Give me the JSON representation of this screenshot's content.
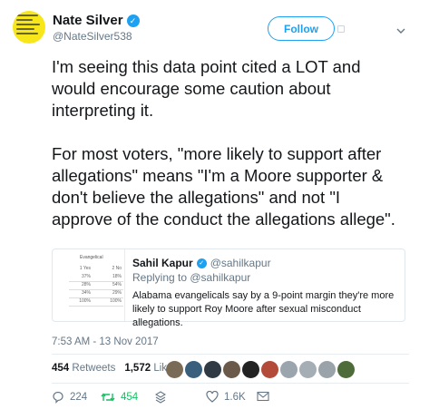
{
  "tweet": {
    "display_name": "Nate Silver",
    "handle": "@NateSilver538",
    "follow_label": "Follow",
    "verified_mark": "✓",
    "paragraphs": [
      "I'm seeing this data point cited a LOT and would encourage some caution about interpreting it.",
      "For most voters, \"more likely to support after allegations\" means \"I'm a Moore supporter & don't believe the allegations\" and not \"I approve of the conduct the allegations allege\"."
    ],
    "timestamp": "7:53 AM - 13 Nov 2017"
  },
  "quote": {
    "name": "Sahil Kapur",
    "handle": "@sahilkapur",
    "replying_prefix": "Replying to ",
    "replying_to": "@sahilkapur",
    "text": "Alabama evangelicals say by a 9-point margin they're more likely to support Roy Moore after sexual misconduct allegations.",
    "thumb": {
      "heading": "Evangelical",
      "cols": [
        "1 Yes",
        "2 No"
      ],
      "rows": [
        [
          "37%",
          "18%"
        ],
        [
          "28%",
          "54%"
        ],
        [
          "34%",
          "29%"
        ],
        [
          "100%",
          "100%"
        ]
      ]
    }
  },
  "stats": {
    "retweets": "454",
    "retweets_label": "Retweets",
    "likes": "1,572",
    "likes_label": "Likes"
  },
  "likers": [
    "#7a6b57",
    "#3a5f7d",
    "#2f3a44",
    "#6b5a4a",
    "#222222",
    "#b34a3a",
    "#9aa5ad",
    "#a5adb5",
    "#9aa3aa",
    "#4e6b3a"
  ],
  "actions": {
    "replies": "224",
    "retweets": "454",
    "likes": "1.6K"
  },
  "colors": {
    "accent": "#1da1f2",
    "retweet_green": "#17bf63",
    "muted": "#657786",
    "avatar_bg": "#f6e61a"
  }
}
